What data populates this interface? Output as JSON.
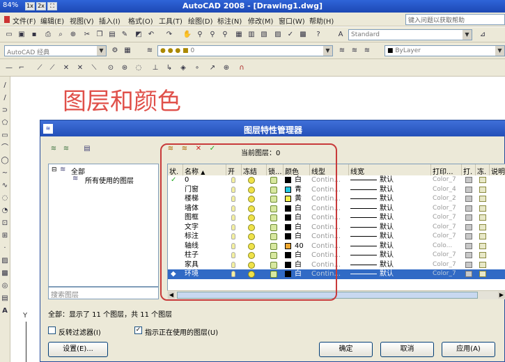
{
  "app": {
    "title": "AutoCAD 2008 - [Drawing1.dwg]",
    "zoom_pct": "84%",
    "zoom_btns": [
      "1x",
      "2x",
      "⛶"
    ]
  },
  "menu": [
    "文件(F)",
    "编辑(E)",
    "视图(V)",
    "插入(I)",
    "格式(O)",
    "工具(T)",
    "绘图(D)",
    "标注(N)",
    "修改(M)",
    "窗口(W)",
    "帮助(H)"
  ],
  "help_placeholder": "键入问题以获取帮助",
  "toolbar": {
    "text_style": "Standard",
    "workspace": "AutoCAD 经典",
    "layer_current": "0",
    "color_current": "ByLayer"
  },
  "heading": "图层和颜色",
  "dialog": {
    "title": "图层特性管理器",
    "current_layer_label": "当前图层：",
    "current_layer_value": "0",
    "tree_root": "全部",
    "tree_child": "所有使用的图层",
    "search_placeholder": "搜索图层",
    "summary": "全部：显示了 11 个图层，共 11 个图层",
    "invert_filter_label": "反转过滤器(I)",
    "show_used_label": "指示正在使用的图层(U)",
    "settings_btn": "设置(E)...",
    "ok_btn": "确定",
    "cancel_btn": "取消",
    "apply_btn": "应用(A)"
  },
  "columns": [
    "状.",
    "名称",
    "开",
    "冻结",
    "锁...",
    "颜色",
    "线型",
    "线宽",
    "打印...",
    "打.",
    "冻.",
    "说明"
  ],
  "layers": [
    {
      "name": "0",
      "color_name": "白",
      "color_hex": "#000000",
      "linetype": "Contin...",
      "lineweight": "默认",
      "plot_style": "Color_7",
      "current": true
    },
    {
      "name": "门窗",
      "color_name": "青",
      "color_hex": "#22c8e0",
      "linetype": "Contin...",
      "lineweight": "默认",
      "plot_style": "Color_4"
    },
    {
      "name": "楼梯",
      "color_name": "黄",
      "color_hex": "#f4f04a",
      "linetype": "Contin...",
      "lineweight": "默认",
      "plot_style": "Color_2"
    },
    {
      "name": "墙体",
      "color_name": "白",
      "color_hex": "#000000",
      "linetype": "Contin...",
      "lineweight": "默认",
      "plot_style": "Color_7"
    },
    {
      "name": "图框",
      "color_name": "白",
      "color_hex": "#000000",
      "linetype": "Contin...",
      "lineweight": "默认",
      "plot_style": "Color_7"
    },
    {
      "name": "文字",
      "color_name": "白",
      "color_hex": "#000000",
      "linetype": "Contin...",
      "lineweight": "默认",
      "plot_style": "Color_7"
    },
    {
      "name": "标注",
      "color_name": "白",
      "color_hex": "#000000",
      "linetype": "Contin...",
      "lineweight": "默认",
      "plot_style": "Color_7"
    },
    {
      "name": "轴线",
      "color_name": "40",
      "color_hex": "#f0a830",
      "linetype": "Contin...",
      "lineweight": "默认",
      "plot_style": "Colo..."
    },
    {
      "name": "柱子",
      "color_name": "白",
      "color_hex": "#000000",
      "linetype": "Contin...",
      "lineweight": "默认",
      "plot_style": "Color_7"
    },
    {
      "name": "家具",
      "color_name": "白",
      "color_hex": "#000000",
      "linetype": "Contin...",
      "lineweight": "默认",
      "plot_style": "Color_7"
    },
    {
      "name": "环境",
      "color_name": "白",
      "color_hex": "#000000",
      "linetype": "Contin...",
      "lineweight": "默认",
      "plot_style": "Color_7",
      "selected": true
    }
  ],
  "colors": {
    "heading": "#e0504a",
    "highlight_box": "#c83a3a",
    "selection": "#316ac5",
    "title_bar": "#2450b8"
  }
}
